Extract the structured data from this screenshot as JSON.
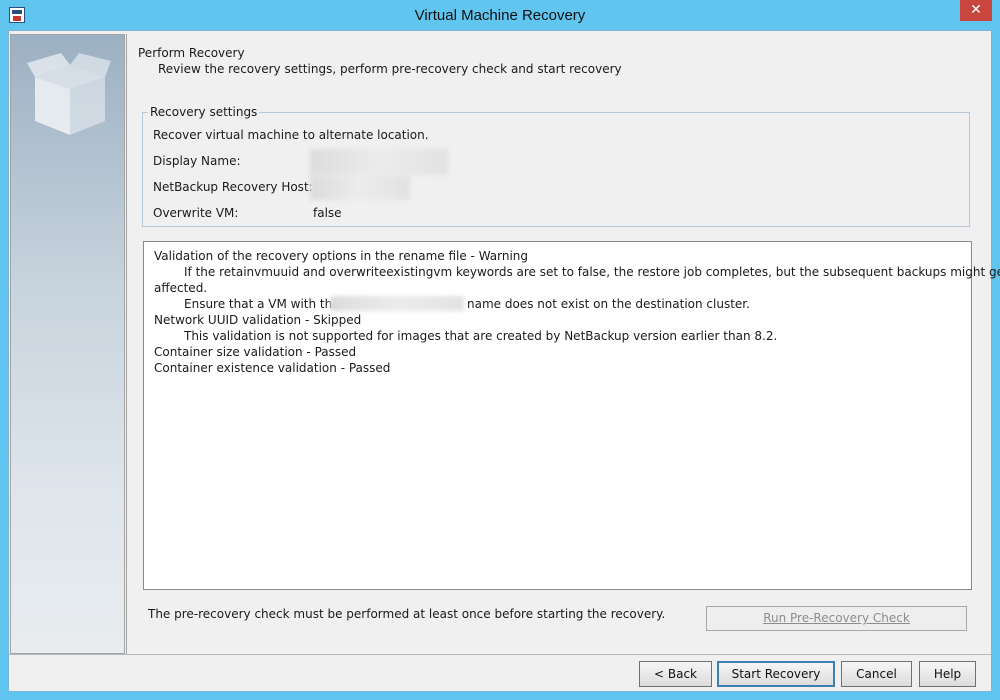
{
  "window": {
    "title": "Virtual Machine Recovery",
    "close_glyph": "✕"
  },
  "header": {
    "title": "Perform Recovery",
    "subtitle": "Review the recovery settings, perform pre-recovery check and start recovery"
  },
  "settings": {
    "legend": "Recovery settings",
    "description": "Recover virtual machine to alternate location.",
    "display_name_label": "Display Name:",
    "recovery_host_label": "NetBackup Recovery Host:",
    "overwrite_label": "Overwrite VM:",
    "overwrite_value": "false"
  },
  "log": {
    "lines": [
      "Validation of the recovery options in the rename file - Warning",
      "If the retainvmuuid and overwriteexistingvm keywords are set to false, the restore job completes, but the subsequent backups might get",
      "affected.",
      "Ensure that a VM with the",
      "name does not exist on the destination cluster.",
      "Network UUID validation - Skipped",
      "This validation is not supported for images that are created by NetBackup version earlier than 8.2.",
      "Container size validation - Passed",
      "Container existence validation - Passed"
    ]
  },
  "footer": {
    "note": "The pre-recovery check must be performed at least once before starting the recovery.",
    "precheck_button": "Run Pre-Recovery Check"
  },
  "buttons": {
    "back": "< Back",
    "start": "Start Recovery",
    "cancel": "Cancel",
    "help": "Help"
  },
  "colors": {
    "titlebar": "#60c5ef",
    "close": "#c7463e",
    "dialog_bg": "#f0f0f0"
  }
}
